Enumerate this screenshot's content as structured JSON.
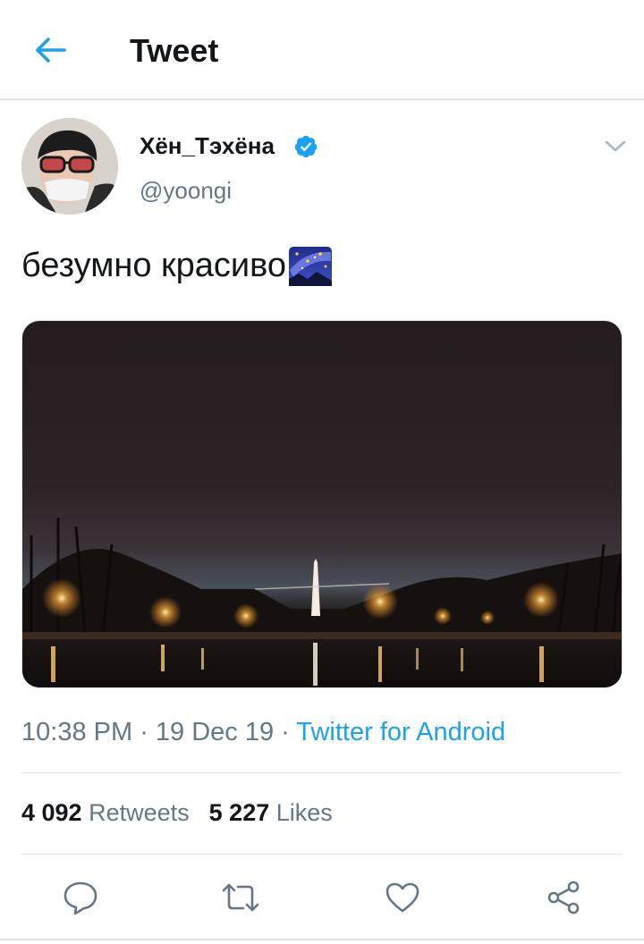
{
  "header": {
    "title": "Tweet"
  },
  "tweet": {
    "author": {
      "display_name": "Хён_Тэхёна",
      "handle": "@yoongi",
      "verified": true
    },
    "text": "безумно красиво",
    "emoji_icon": "milky-way-emoji",
    "meta": {
      "time": "10:38 PM",
      "separator": " · ",
      "date": "19 Dec 19",
      "source": "Twitter for Android"
    },
    "stats": {
      "retweets_count": "4 092",
      "retweets_label": "Retweets",
      "likes_count": "5 227",
      "likes_label": "Likes"
    }
  },
  "icons": {
    "back": "arrow-left-icon",
    "verified": "verified-badge-icon",
    "caret": "chevron-down-icon",
    "reply": "reply-icon",
    "retweet": "retweet-icon",
    "like": "heart-icon",
    "share": "share-icon"
  },
  "colors": {
    "accent": "#1da1f2",
    "secondary_text": "#657786",
    "primary_text": "#14171a",
    "divider": "#e1e8ed"
  }
}
